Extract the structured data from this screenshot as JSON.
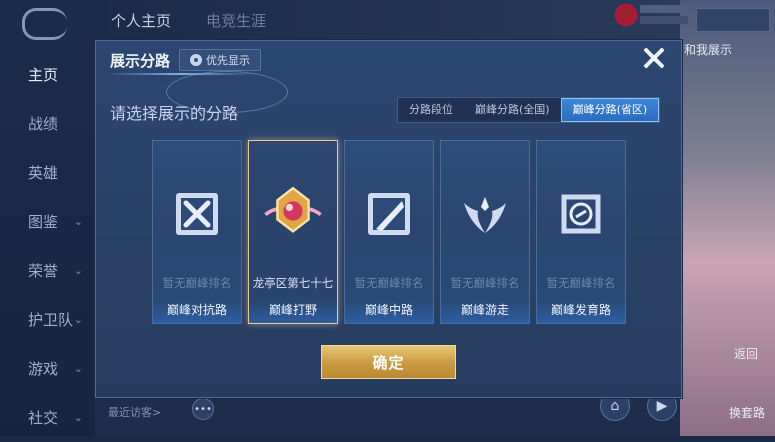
{
  "top_tabs": [
    "个人主页",
    "电竞生涯"
  ],
  "nav": [
    {
      "label": "主页",
      "active": true,
      "chevron": false
    },
    {
      "label": "战绩",
      "active": false,
      "chevron": false
    },
    {
      "label": "英雄",
      "active": false,
      "chevron": false
    },
    {
      "label": "图鉴",
      "active": false,
      "chevron": true
    },
    {
      "label": "荣誉",
      "active": false,
      "chevron": true
    },
    {
      "label": "护卫队",
      "active": false,
      "chevron": true
    },
    {
      "label": "游戏",
      "active": false,
      "chevron": true
    },
    {
      "label": "社交",
      "active": false,
      "chevron": true
    }
  ],
  "right_panel": {
    "partial_text": "和我展示",
    "btn1": "返回",
    "btn2": "换套路"
  },
  "recent_visitors": "最近访客>",
  "dialog": {
    "title": "展示分路",
    "priority_label": "优先显示",
    "subtitle": "请选择展示的分路",
    "tabs": [
      {
        "label": "分路段位",
        "active": false
      },
      {
        "label": "巅峰分路(全国)",
        "active": false
      },
      {
        "label": "巅峰分路(省区)",
        "active": true
      }
    ],
    "cards": [
      {
        "rank": "暂无巅峰排名",
        "role": "巅峰对抗路",
        "icon": "swords-icon",
        "selected": false
      },
      {
        "rank": "龙亭区第七十七",
        "role": "巅峰打野",
        "icon": "jungle-gem-icon",
        "selected": true
      },
      {
        "rank": "暂无巅峰排名",
        "role": "巅峰中路",
        "icon": "blade-icon",
        "selected": false
      },
      {
        "rank": "暂无巅峰排名",
        "role": "巅峰游走",
        "icon": "wings-icon",
        "selected": false
      },
      {
        "rank": "暂无巅峰排名",
        "role": "巅峰发育路",
        "icon": "coin-target-icon",
        "selected": false
      }
    ],
    "confirm_label": "确定"
  }
}
